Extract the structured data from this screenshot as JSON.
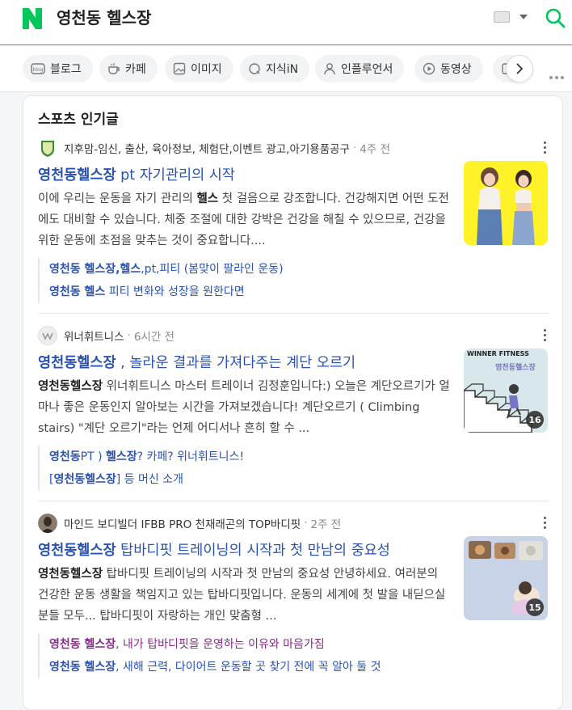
{
  "header": {
    "query": "영천동 헬스장"
  },
  "tabs": [
    {
      "label": "블로그",
      "icon": "blog-icon"
    },
    {
      "label": "카페",
      "icon": "cafe-icon"
    },
    {
      "label": "이미지",
      "icon": "image-icon"
    },
    {
      "label": "지식iN",
      "icon": "kin-icon"
    },
    {
      "label": "인플루언서",
      "icon": "person-icon"
    },
    {
      "label": "동영상",
      "icon": "play-icon"
    }
  ],
  "section": {
    "title": "스포츠 인기글"
  },
  "posts": [
    {
      "author": "지후맘-임신, 출산, 육아정보, 체험단,이벤트 광고,아기용품공구",
      "time": "4주 전",
      "title_bold": "영천동헬스장",
      "title_rest": " pt 자기관리의 시작",
      "body_a": "이에 우리는 운동을 자기 관리의 ",
      "body_b": "헬스",
      "body_c": " 첫 걸음으로 강조합니다. 건강해지면 어떤 도전에도 대비할 수 있습니다. 체중 조절에 대한 강박은 건강을 해칠 수 있으므로, 건강을 위한 운동에 초점을 맞추는 것이 중요합니다....",
      "sub1_bold": "영천동 헬스장,헬스",
      "sub1_rest": ",pt,피티 (봄맞이 팔라인 운동)",
      "sub2_bold": "영천동 헬스",
      "sub2_rest": " 피티 변화와 성장을 원한다면"
    },
    {
      "author": "위너휘트니스",
      "time": "6시간 전",
      "title_bold": "영천동헬스장",
      "title_rest": " , 놀라운 결과를 가져다주는 계단 오르기",
      "body_a": "",
      "body_b": "영천동헬스장",
      "body_c": " 위너휘트니스 마스터 트레이너 김정훈입니다:) 오늘은 계단오르기가 얼마나 좋은 운동인지 알아보는 시간을 가져보겠습니다! 계단오르기 ( Climbing stairs) \"계단 오르기\"라는 언제 어디서나 흔히 할 수 ...",
      "thumb_brand": "WINNER FITNESS",
      "thumb_count": "16",
      "sub1_bold": "영천동",
      "sub1_mid": "PT ) ",
      "sub1_bold2": "헬스장",
      "sub1_rest": "? 카페? 위너휘트니스!",
      "sub2_pre": "[",
      "sub2_bold": "영천동헬스장",
      "sub2_rest": "] 등 머신 소개"
    },
    {
      "author": "마인드 보디빌더 IFBB PRO 천재래곤의 TOP바디핏",
      "time": "2주 전",
      "title_bold": "영천동헬스장",
      "title_rest": " 탑바디핏 트레이닝의 시작과 첫 만남의 중요성",
      "body_a": "",
      "body_b": "영천동헬스장",
      "body_c": " 탑바디핏 트레이닝의 시작과 첫 만남의 중요성 안녕하세요. 여러분의 건강한 운동 생활을 책임지고 있는 탑바디핏입니다. 운동의 세계에 첫 발을 내딛으실 분들 모두... 탑바디핏이 자랑하는 개인 맞춤형 ...",
      "thumb_count": "15",
      "sub1_bold": "영천동 헬스장",
      "sub1_rest": ", 내가 탑바디핏을 운영하는 이유와 마음가짐",
      "sub2_bold": "영천동 헬스장",
      "sub2_rest": ", 새해 근력, 다이어트 운동할 곳 찾기 전에 꼭 알아 둘 것"
    }
  ],
  "colors": {
    "brand": "#03c75a",
    "link": "#2952b3",
    "visited": "#8a2b89"
  }
}
